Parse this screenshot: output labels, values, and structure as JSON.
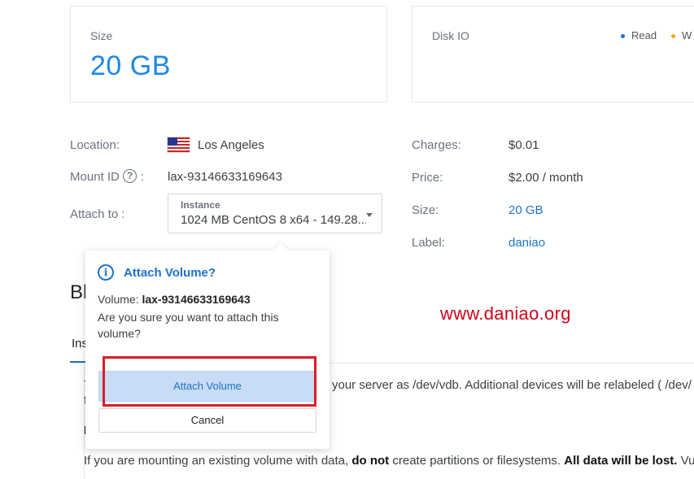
{
  "size_card": {
    "label": "Size",
    "value": "20 GB"
  },
  "disk_card": {
    "label": "Disk IO",
    "legend": [
      {
        "label": "Read",
        "color": "#1e73c8"
      },
      {
        "label": "W",
        "color": "#f5a623"
      }
    ]
  },
  "details_left": {
    "location_label": "Location:",
    "location_value": "Los Angeles",
    "location_flag": "us-flag-icon",
    "mount_label": "Mount ID",
    "mount_help_icon": "?",
    "mount_colon": ":",
    "mount_value": "lax-93146633169643",
    "attach_label": "Attach to :",
    "attach_select": {
      "label": "Instance",
      "value": "1024 MB CentOS 8 x64 - 149.28...."
    }
  },
  "details_right": {
    "charges_label": "Charges:",
    "charges_value": "$0.01",
    "price_label": "Price:",
    "price_value": "$2.00 / month",
    "size_label": "Size:",
    "size_value": "20 GB",
    "label_label": "Label:",
    "label_value": "daniao"
  },
  "background": {
    "heading": "Bl",
    "tab": "Ins",
    "line1_prefix": "T",
    "line1_rest": "your server as /dev/vdb. Additional devices will be relabeled ( /dev/",
    "line2": "f",
    "line3": "I",
    "line4_a": "If you are mounting an existing volume with data, ",
    "line4_b": "do not",
    "line4_c": " create partitions or filesystems. ",
    "line4_d": "All data will be lost.",
    "line4_e": " Vult"
  },
  "watermark": "www.daniao.org",
  "popover": {
    "icon": "info-icon",
    "title": "Attach Volume?",
    "volume_prefix": "Volume: ",
    "volume_id": "lax-93146633169643",
    "message": "Are you sure you want to attach this volume?",
    "confirm_label": "Attach Volume",
    "cancel_label": "Cancel"
  }
}
